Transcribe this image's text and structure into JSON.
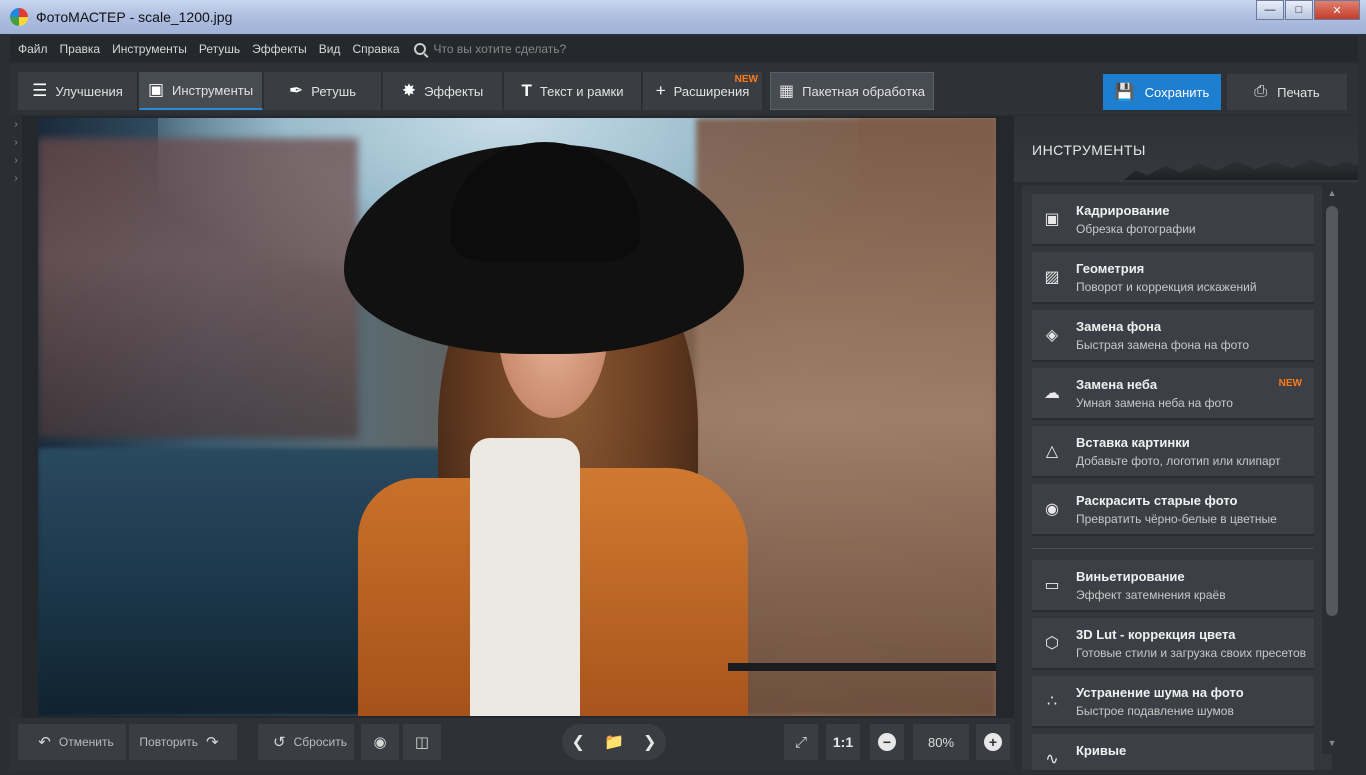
{
  "window": {
    "title": "ФотоМАСТЕР - scale_1200.jpg"
  },
  "menu": {
    "items": [
      "Файл",
      "Правка",
      "Инструменты",
      "Ретушь",
      "Эффекты",
      "Вид",
      "Справка"
    ],
    "search_placeholder": "Что вы хотите сделать?"
  },
  "toolbar": {
    "tabs": [
      {
        "label": "Улучшения",
        "icon": "sliders-icon"
      },
      {
        "label": "Инструменты",
        "icon": "crop-icon",
        "active": true
      },
      {
        "label": "Ретушь",
        "icon": "brush-icon"
      },
      {
        "label": "Эффекты",
        "icon": "magic-wand-icon"
      },
      {
        "label": "Текст и рамки",
        "icon": "text-icon"
      },
      {
        "label": "Расширения",
        "icon": "plus-icon",
        "badge": "NEW"
      }
    ],
    "batch_label": "Пакетная обработка",
    "save_label": "Сохранить",
    "print_label": "Печать"
  },
  "bottombar": {
    "undo_label": "Отменить",
    "redo_label": "Повторить",
    "reset_label": "Сбросить",
    "actual_size_label": "1:1",
    "zoom_value": "80%"
  },
  "panel": {
    "title": "ИНСТРУМЕНТЫ",
    "tools": [
      {
        "title": "Кадрирование",
        "subtitle": "Обрезка фотографии",
        "icon": "crop-icon"
      },
      {
        "title": "Геометрия",
        "subtitle": "Поворот и коррекция искажений",
        "icon": "geometry-icon"
      },
      {
        "title": "Замена фона",
        "subtitle": "Быстрая замена фона на фото",
        "icon": "fill-bucket-icon"
      },
      {
        "title": "Замена неба",
        "subtitle": "Умная замена неба на фото",
        "icon": "cloud-icon",
        "badge": "NEW"
      },
      {
        "title": "Вставка картинки",
        "subtitle": "Добавьте фото, логотип или клипарт",
        "icon": "insert-image-icon"
      },
      {
        "title": "Раскрасить старые фото",
        "subtitle": "Превратить чёрно-белые в цветные",
        "icon": "palette-icon"
      },
      {
        "title": "Виньетирование",
        "subtitle": "Эффект затемнения краёв",
        "icon": "vignette-icon"
      },
      {
        "title": "3D Lut - коррекция цвета",
        "subtitle": "Готовые стили и загрузка своих пресетов",
        "icon": "cube-icon"
      },
      {
        "title": "Устранение шума на фото",
        "subtitle": "Быстрое подавление шумов",
        "icon": "noise-icon"
      },
      {
        "title": "Кривые",
        "subtitle": "",
        "icon": "curves-icon"
      }
    ]
  },
  "colors": {
    "accent": "#1e7fd0",
    "new_badge": "#ff7a1a"
  }
}
